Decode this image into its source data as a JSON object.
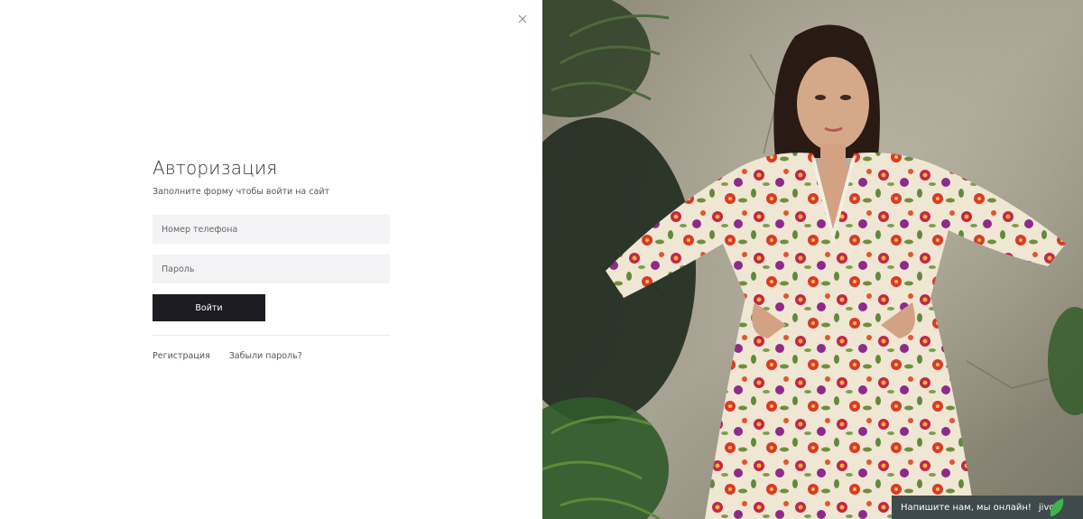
{
  "auth": {
    "title": "Авторизация",
    "subtitle": "Заполните форму чтобы войти на сайт",
    "phone_placeholder": "Номер телефона",
    "password_placeholder": "Пароль",
    "submit_label": "Войти",
    "register_link": "Регистрация",
    "forgot_link": "Забыли пароль?"
  },
  "close": {
    "icon": "close-icon"
  },
  "chat": {
    "text": "Напишите нам, мы онлайн!",
    "brand": "jivo",
    "icon": "leaf-icon"
  },
  "colors": {
    "button_bg": "#1c1c22",
    "input_bg": "#f3f3f5",
    "chat_bg": "#3f4a4c",
    "chat_leaf": "#3cb54a"
  }
}
